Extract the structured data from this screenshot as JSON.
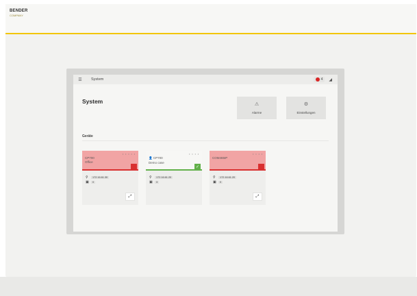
{
  "brand": {
    "name": "BENDER",
    "tagline": "COMPANY"
  },
  "topbar": {
    "menu_icon": "hamburger-icon",
    "title": "System",
    "alarm_count": "4",
    "user_icon": "user-icon"
  },
  "page": {
    "title": "System"
  },
  "tiles": [
    {
      "label": "Alarme",
      "icon": "warning-icon"
    },
    {
      "label": "Einstellungen",
      "icon": "gear-icon"
    }
  ],
  "devices": {
    "section_label": "Geräte",
    "items": [
      {
        "name": "CP700",
        "subtitle": "Office",
        "ip": "172.16.61.30",
        "count": "0",
        "state": "alarm"
      },
      {
        "name": "CP700",
        "subtitle": "Demo case",
        "ip": "172.16.61.20",
        "count": "3",
        "state": "ok"
      },
      {
        "name": "COM465IP",
        "subtitle": "",
        "ip": "172.16.61.20",
        "count": "0",
        "state": "alarm"
      }
    ]
  },
  "colors": {
    "accent": "#f2c500",
    "alarm": "#d93030",
    "alarm_bg": "#f1a4a4",
    "ok": "#62b04a"
  }
}
